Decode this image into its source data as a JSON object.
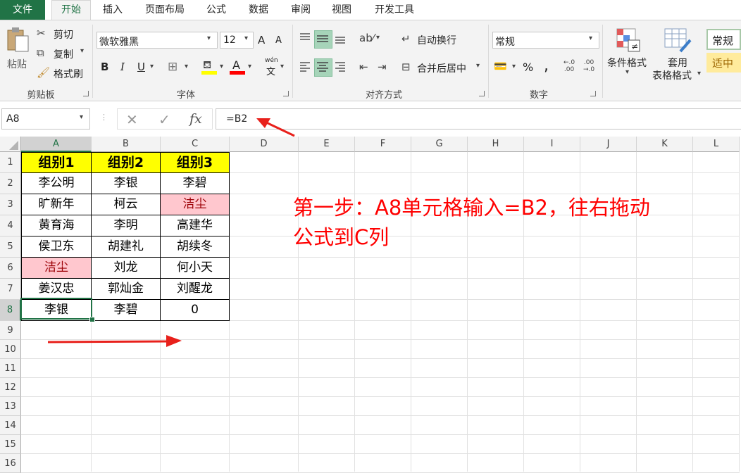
{
  "tabs": [
    "文件",
    "开始",
    "插入",
    "页面布局",
    "公式",
    "数据",
    "审阅",
    "视图",
    "开发工具"
  ],
  "ribbon": {
    "clipboard": {
      "paste": "粘贴",
      "cut": "剪切",
      "copy": "复制",
      "painter": "格式刷",
      "label": "剪贴板"
    },
    "font": {
      "name": "微软雅黑",
      "size": "12",
      "bold": "B",
      "italic": "I",
      "underline": "U",
      "grow": "A",
      "shrink": "A",
      "font_color": "A",
      "phonetic": "wén",
      "label": "字体"
    },
    "alignment": {
      "wrap": "自动换行",
      "merge": "合并后居中",
      "label": "对齐方式"
    },
    "number": {
      "format": "常规",
      "label": "数字",
      "percent": "%",
      "comma": ","
    },
    "styles": {
      "conditional": "条件格式",
      "table_1": "套用",
      "table_2": "表格格式",
      "normal": "常规",
      "neutral": "适中"
    }
  },
  "formula_bar": {
    "name_box": "A8",
    "formula": "=B2",
    "fx": "fx"
  },
  "columns": [
    "A",
    "B",
    "C",
    "D",
    "E",
    "F",
    "G",
    "H",
    "I",
    "J",
    "K",
    "L"
  ],
  "rows": [
    "1",
    "2",
    "3",
    "4",
    "5",
    "6",
    "7",
    "8",
    "9",
    "10",
    "11",
    "12",
    "13",
    "14",
    "15",
    "16"
  ],
  "table": [
    [
      "组别1",
      "组别2",
      "组别3"
    ],
    [
      "李公明",
      "李银",
      "李碧"
    ],
    [
      "旷新年",
      "柯云",
      "洁尘"
    ],
    [
      "黄育海",
      "李明",
      "高建华"
    ],
    [
      "侯卫东",
      "胡建礼",
      "胡续冬"
    ],
    [
      "洁尘",
      "刘龙",
      "何小天"
    ],
    [
      "姜汉忠",
      "郭灿金",
      "刘醒龙"
    ],
    [
      "李银",
      "李碧",
      "0"
    ]
  ],
  "note": {
    "line1": "第一步：A8单元格输入=B2，往右拖动",
    "line2": "公式到C列"
  },
  "colors": {
    "accent": "#217346",
    "header_fill": "#ffff00",
    "dup_fill": "#ffc7ce",
    "dup_text": "#9c0006",
    "note": "#ff0000"
  }
}
